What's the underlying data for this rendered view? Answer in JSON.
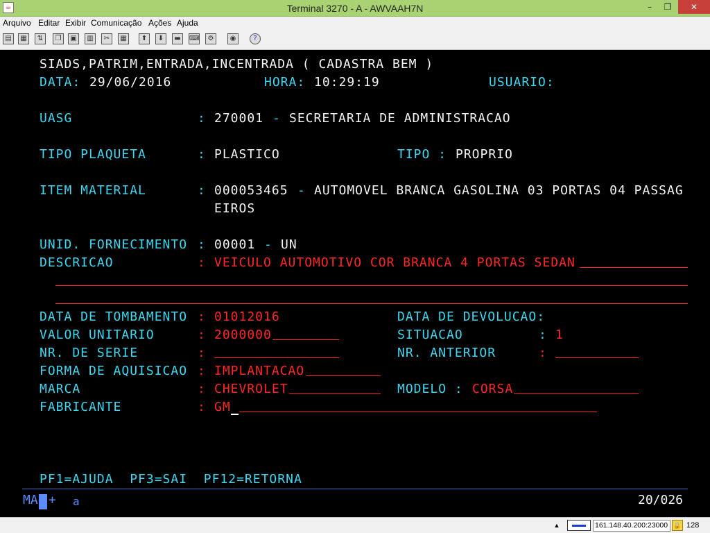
{
  "window": {
    "title": "Terminal 3270 - A - AWVAAH7N",
    "app_icon": "java-icon",
    "controls": {
      "minimize": "–",
      "maximize": "❐",
      "close": "✕"
    }
  },
  "menu": [
    "Arquivo",
    "Editar",
    "Exibir",
    "Comunicação",
    "Ações",
    "Ajuda"
  ],
  "toolbar": {
    "icons": [
      "print-screen-icon",
      "print-setup-icon",
      "transfer-icon",
      "copy-icon",
      "paste-icon",
      "paste-next-icon",
      "cut-icon",
      "select-all-icon",
      "send-file-icon",
      "receive-file-icon",
      "macro-icon",
      "keyboard-icon",
      "settings-icon",
      "help-icon"
    ]
  },
  "screen": {
    "header": {
      "title": "SIADS,PATRIM,ENTRADA,INCENTRADA ( CADASTRA BEM )",
      "data_label": "DATA:",
      "data_value": "29/06/2016",
      "hora_label": "HORA:",
      "hora_value": "10:29:19",
      "usuario_label": "USUARIO:"
    },
    "uasg": {
      "label": "UASG",
      "sep": ":",
      "code": "270001",
      "dash": "-",
      "name": "SECRETARIA DE ADMINISTRACAO"
    },
    "tipo_plaqueta": {
      "label": "TIPO PLAQUETA",
      "sep": ":",
      "value": "PLASTICO",
      "tipo_label": "TIPO :",
      "tipo_value": "PROPRIO"
    },
    "item_material": {
      "label": "ITEM MATERIAL",
      "sep": ":",
      "code": "000053465",
      "dash": "-",
      "desc_line1": "AUTOMOVEL BRANCA GASOLINA 03 PORTAS 04 PASSAG",
      "desc_line2": "EIROS"
    },
    "unid_fornecimento": {
      "label": "UNID. FORNECIMENTO",
      "sep": ":",
      "code": "00001",
      "dash": "-",
      "unit": "UN"
    },
    "descricao": {
      "label": "DESCRICAO",
      "sep": ":",
      "value": "VEICULO AUTOMOTIVO COR BRANCA 4 PORTAS SEDAN"
    },
    "data_tombamento": {
      "label": "DATA DE TOMBAMENTO",
      "sep": ":",
      "value": "01012016"
    },
    "data_devolucao": {
      "label": "DATA DE DEVOLUCAO:"
    },
    "valor_unitario": {
      "label": "VALOR UNITARIO",
      "sep": ":",
      "value": "2000000"
    },
    "situacao": {
      "label": "SITUACAO",
      "sep": ":",
      "value": "1"
    },
    "nr_serie": {
      "label": "NR. DE SERIE",
      "sep": ":",
      "value": ""
    },
    "nr_anterior": {
      "label": "NR. ANTERIOR",
      "sep": ":",
      "value": ""
    },
    "forma_aquisicao": {
      "label": "FORMA DE AQUISICAO",
      "sep": ":",
      "value": "IMPLANTACAO"
    },
    "marca": {
      "label": "MARCA",
      "sep": ":",
      "value": "CHEVROLET"
    },
    "modelo": {
      "label": "MODELO :",
      "value": "CORSA"
    },
    "fabricante": {
      "label": "FABRICANTE",
      "sep": ":",
      "value": "GM"
    },
    "pf_keys": "PF1=AJUDA  PF3=SAI  PF12=RETORNA"
  },
  "oia": {
    "mode": "MA",
    "plus": "+",
    "indicator": "a",
    "cursor_pos": "20/026"
  },
  "status": {
    "scroll": "▲",
    "host": "161.148.40.200:23000",
    "keys": "128"
  },
  "colors": {
    "label": "#3fd6f0",
    "value": "#f4f4f4",
    "input": "#ff2626",
    "background": "#000000",
    "titlebar": "#a9d273"
  }
}
